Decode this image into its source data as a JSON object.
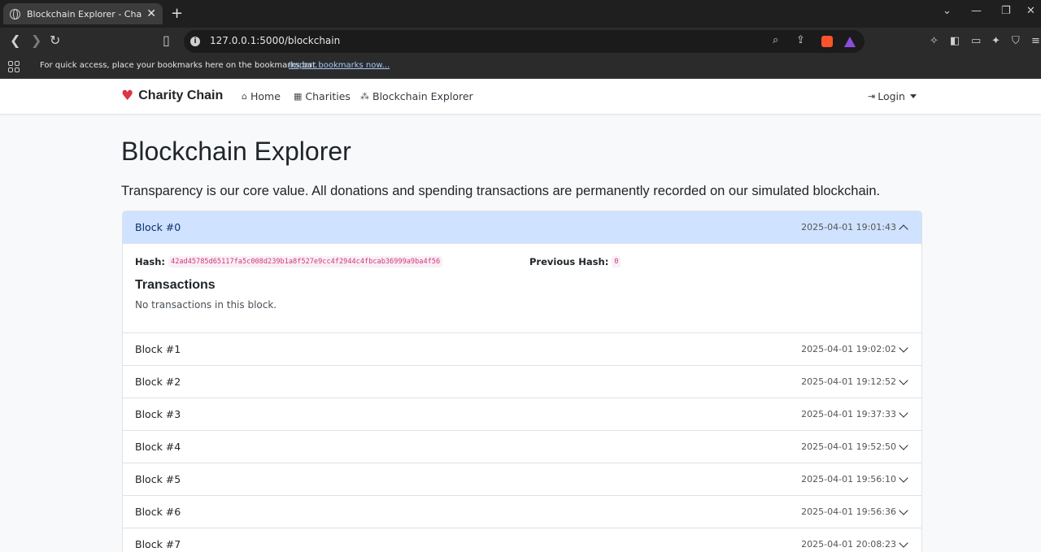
{
  "browser": {
    "tab_title": "Blockchain Explorer - Charity Cl",
    "url": "127.0.0.1:5000/blockchain",
    "bookmarks_hint": "For quick access, place your bookmarks here on the bookmarks bar.",
    "bookmarks_link": "Import bookmarks now..."
  },
  "navbar": {
    "brand": "Charity Chain",
    "links": [
      "Home",
      "Charities",
      "Blockchain Explorer"
    ],
    "login": "Login"
  },
  "main": {
    "title": "Blockchain Explorer",
    "lead": "Transparency is our core value. All donations and spending transactions are permanently recorded on our simulated blockchain."
  },
  "open_block": {
    "label": "Block #0",
    "timestamp": "2025-04-01 19:01:43",
    "hash_label": "Hash:",
    "hash": "42ad45785d65117fa5c008d239b1a8f527e9cc4f2944c4fbcab36999a9ba4f56",
    "prev_hash_label": "Previous Hash:",
    "prev_hash": "0",
    "transactions_title": "Transactions",
    "no_transactions": "No transactions in this block."
  },
  "blocks": [
    {
      "label": "Block #1",
      "timestamp": "2025-04-01 19:02:02"
    },
    {
      "label": "Block #2",
      "timestamp": "2025-04-01 19:12:52"
    },
    {
      "label": "Block #3",
      "timestamp": "2025-04-01 19:37:33"
    },
    {
      "label": "Block #4",
      "timestamp": "2025-04-01 19:52:50"
    },
    {
      "label": "Block #5",
      "timestamp": "2025-04-01 19:56:10"
    },
    {
      "label": "Block #6",
      "timestamp": "2025-04-01 19:56:36"
    },
    {
      "label": "Block #7",
      "timestamp": "2025-04-01 20:08:23"
    }
  ]
}
